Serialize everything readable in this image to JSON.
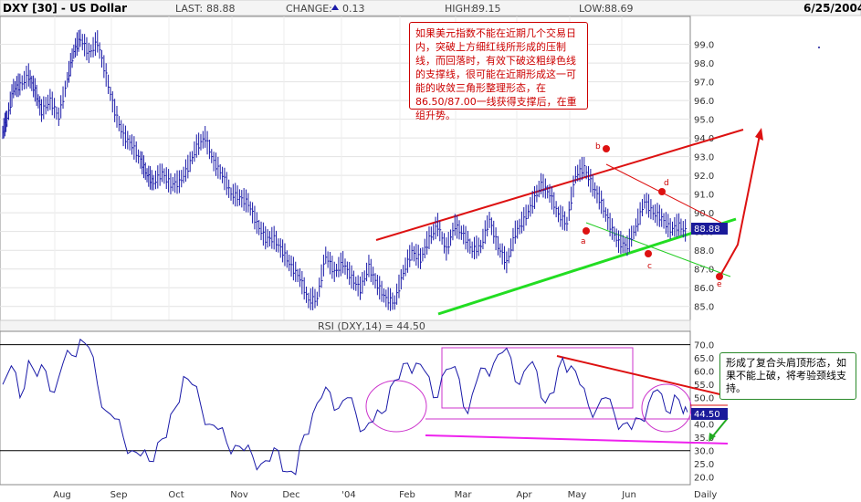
{
  "header": {
    "symbol": "DXY [30] - US Dollar",
    "last_label": "LAST:",
    "last_value": "88.88",
    "change_label": "CHANGE:",
    "change_value": "0.13",
    "high_label": "HIGH:",
    "high_value": "89.15",
    "low_label": "LOW:",
    "low_value": "88.69",
    "date": "6/25/2004"
  },
  "rsi_header": "RSI (DXY,14) = 44.50",
  "price_badge": "88.88",
  "rsi_badge": "44.50",
  "period_label": "Daily",
  "annotations": {
    "top_note": "如果美元指数不能在近期几个交易日内，突破上方细红线所形成的压制线，而回落时，有效下破这粗绿色线的支撑线，很可能在近期形成这一可能的收敛三角形整理形态，在86.50/87.00一线获得支撑后，在重组升势。",
    "right_note": "形成了复合头肩顶形态，如果不能上破，将考验颈线支持。",
    "point_labels": [
      "a",
      "b",
      "c",
      "d",
      "e"
    ]
  },
  "colors": {
    "price_line": "#1a1aa8",
    "resistance": "#dd1111",
    "support": "#22cc22",
    "rsi_line": "#1a1aa8",
    "rsi_circle": "#cc33cc",
    "badge_bg": "#1a1a9a"
  },
  "chart_data": [
    {
      "type": "line",
      "title": "DXY [30] - US Dollar",
      "x_ticks": [
        "Aug",
        "Sep",
        "Oct",
        "Nov",
        "Dec",
        "'04",
        "Feb",
        "Mar",
        "Apr",
        "May",
        "Jun",
        "Daily"
      ],
      "y_ticks": [
        85.0,
        86.0,
        87.0,
        88.0,
        89.0,
        90.0,
        91.0,
        92.0,
        93.0,
        94.0,
        95.0,
        96.0,
        97.0,
        98.0,
        99.0
      ],
      "ylim": [
        84.4,
        100.3
      ],
      "grid": true,
      "series": [
        {
          "x": [
            0,
            2,
            5,
            8,
            12,
            15,
            18,
            22,
            26,
            30,
            33,
            36,
            40,
            44,
            48,
            52,
            56,
            60,
            64,
            67,
            70,
            74,
            78,
            82,
            86,
            90,
            94,
            98,
            102,
            106,
            110,
            114,
            118,
            122,
            126,
            130,
            134,
            138,
            142,
            146,
            150,
            154,
            158,
            162,
            166,
            170,
            174,
            178,
            182,
            186,
            190,
            194,
            198,
            202,
            206,
            210,
            214,
            218,
            222,
            226,
            230,
            234,
            238,
            242,
            246,
            250,
            254,
            258,
            262,
            266,
            270,
            274,
            278,
            282,
            286,
            290,
            294,
            298,
            302,
            306,
            310,
            314,
            318
          ],
          "y": [
            94.3,
            95.0,
            96.6,
            96.8,
            97.3,
            96.5,
            95.4,
            96.0,
            95.1,
            97.1,
            98.6,
            99.3,
            98.5,
            99.1,
            97.3,
            95.4,
            94.1,
            93.6,
            92.8,
            92.0,
            91.6,
            92.1,
            91.5,
            91.6,
            92.4,
            93.5,
            94.0,
            92.7,
            92.0,
            91.0,
            90.8,
            90.5,
            89.4,
            88.6,
            88.6,
            87.9,
            87.1,
            86.5,
            85.3,
            85.4,
            87.7,
            86.8,
            87.3,
            86.5,
            85.9,
            87.1,
            86.1,
            85.4,
            85.2,
            86.8,
            87.9,
            87.5,
            88.6,
            89.3,
            88.0,
            89.3,
            88.8,
            88.0,
            88.2,
            89.6,
            88.2,
            87.3,
            88.9,
            89.6,
            90.5,
            91.5,
            91.0,
            89.9,
            89.4,
            92.0,
            92.4,
            91.4,
            90.5,
            89.3,
            88.4,
            88.2,
            89.2,
            90.6,
            90.0,
            89.7,
            89.1,
            89.3,
            88.9
          ]
        }
      ]
    },
    {
      "type": "line",
      "title": "RSI (DXY,14) = 44.50",
      "y_ticks": [
        20.0,
        25.0,
        30.0,
        35.0,
        40.0,
        45.0,
        50.0,
        55.0,
        60.0,
        65.0,
        70.0
      ],
      "ylim": [
        17.5,
        74.0
      ],
      "reference_lines": [
        30,
        70
      ],
      "series": [
        {
          "x": [
            0,
            4,
            8,
            12,
            16,
            20,
            24,
            28,
            32,
            36,
            40,
            44,
            48,
            52,
            56,
            60,
            64,
            68,
            72,
            76,
            80,
            84,
            88,
            92,
            96,
            100,
            104,
            108,
            112,
            116,
            120,
            124,
            128,
            132,
            136,
            140,
            144,
            148,
            152,
            156,
            160,
            164,
            168,
            172,
            176,
            180,
            184,
            188,
            192,
            196,
            200,
            204,
            208,
            212,
            216,
            220,
            224,
            228,
            232,
            236,
            240,
            244,
            248,
            252,
            256,
            260,
            264,
            268,
            272,
            276,
            280,
            284,
            288,
            292,
            296,
            300,
            304,
            308,
            312,
            316,
            318
          ],
          "y": [
            55,
            62,
            50,
            64,
            58,
            60,
            52,
            63,
            66,
            72,
            69,
            55,
            45,
            42,
            35,
            30,
            28,
            26,
            33,
            35,
            46,
            58,
            55,
            47,
            40,
            38,
            33,
            32,
            30,
            28,
            25,
            26,
            30,
            22,
            21,
            36,
            44,
            50,
            52,
            46,
            50,
            44,
            38,
            41,
            44,
            54,
            57,
            63,
            63,
            60,
            50,
            58,
            61,
            57,
            44,
            56,
            61,
            63,
            67,
            65,
            55,
            62,
            60,
            48,
            52,
            65,
            62,
            55,
            47,
            46,
            50,
            44,
            40,
            38,
            42,
            48,
            53,
            45,
            51,
            44,
            44.5
          ]
        }
      ]
    }
  ]
}
